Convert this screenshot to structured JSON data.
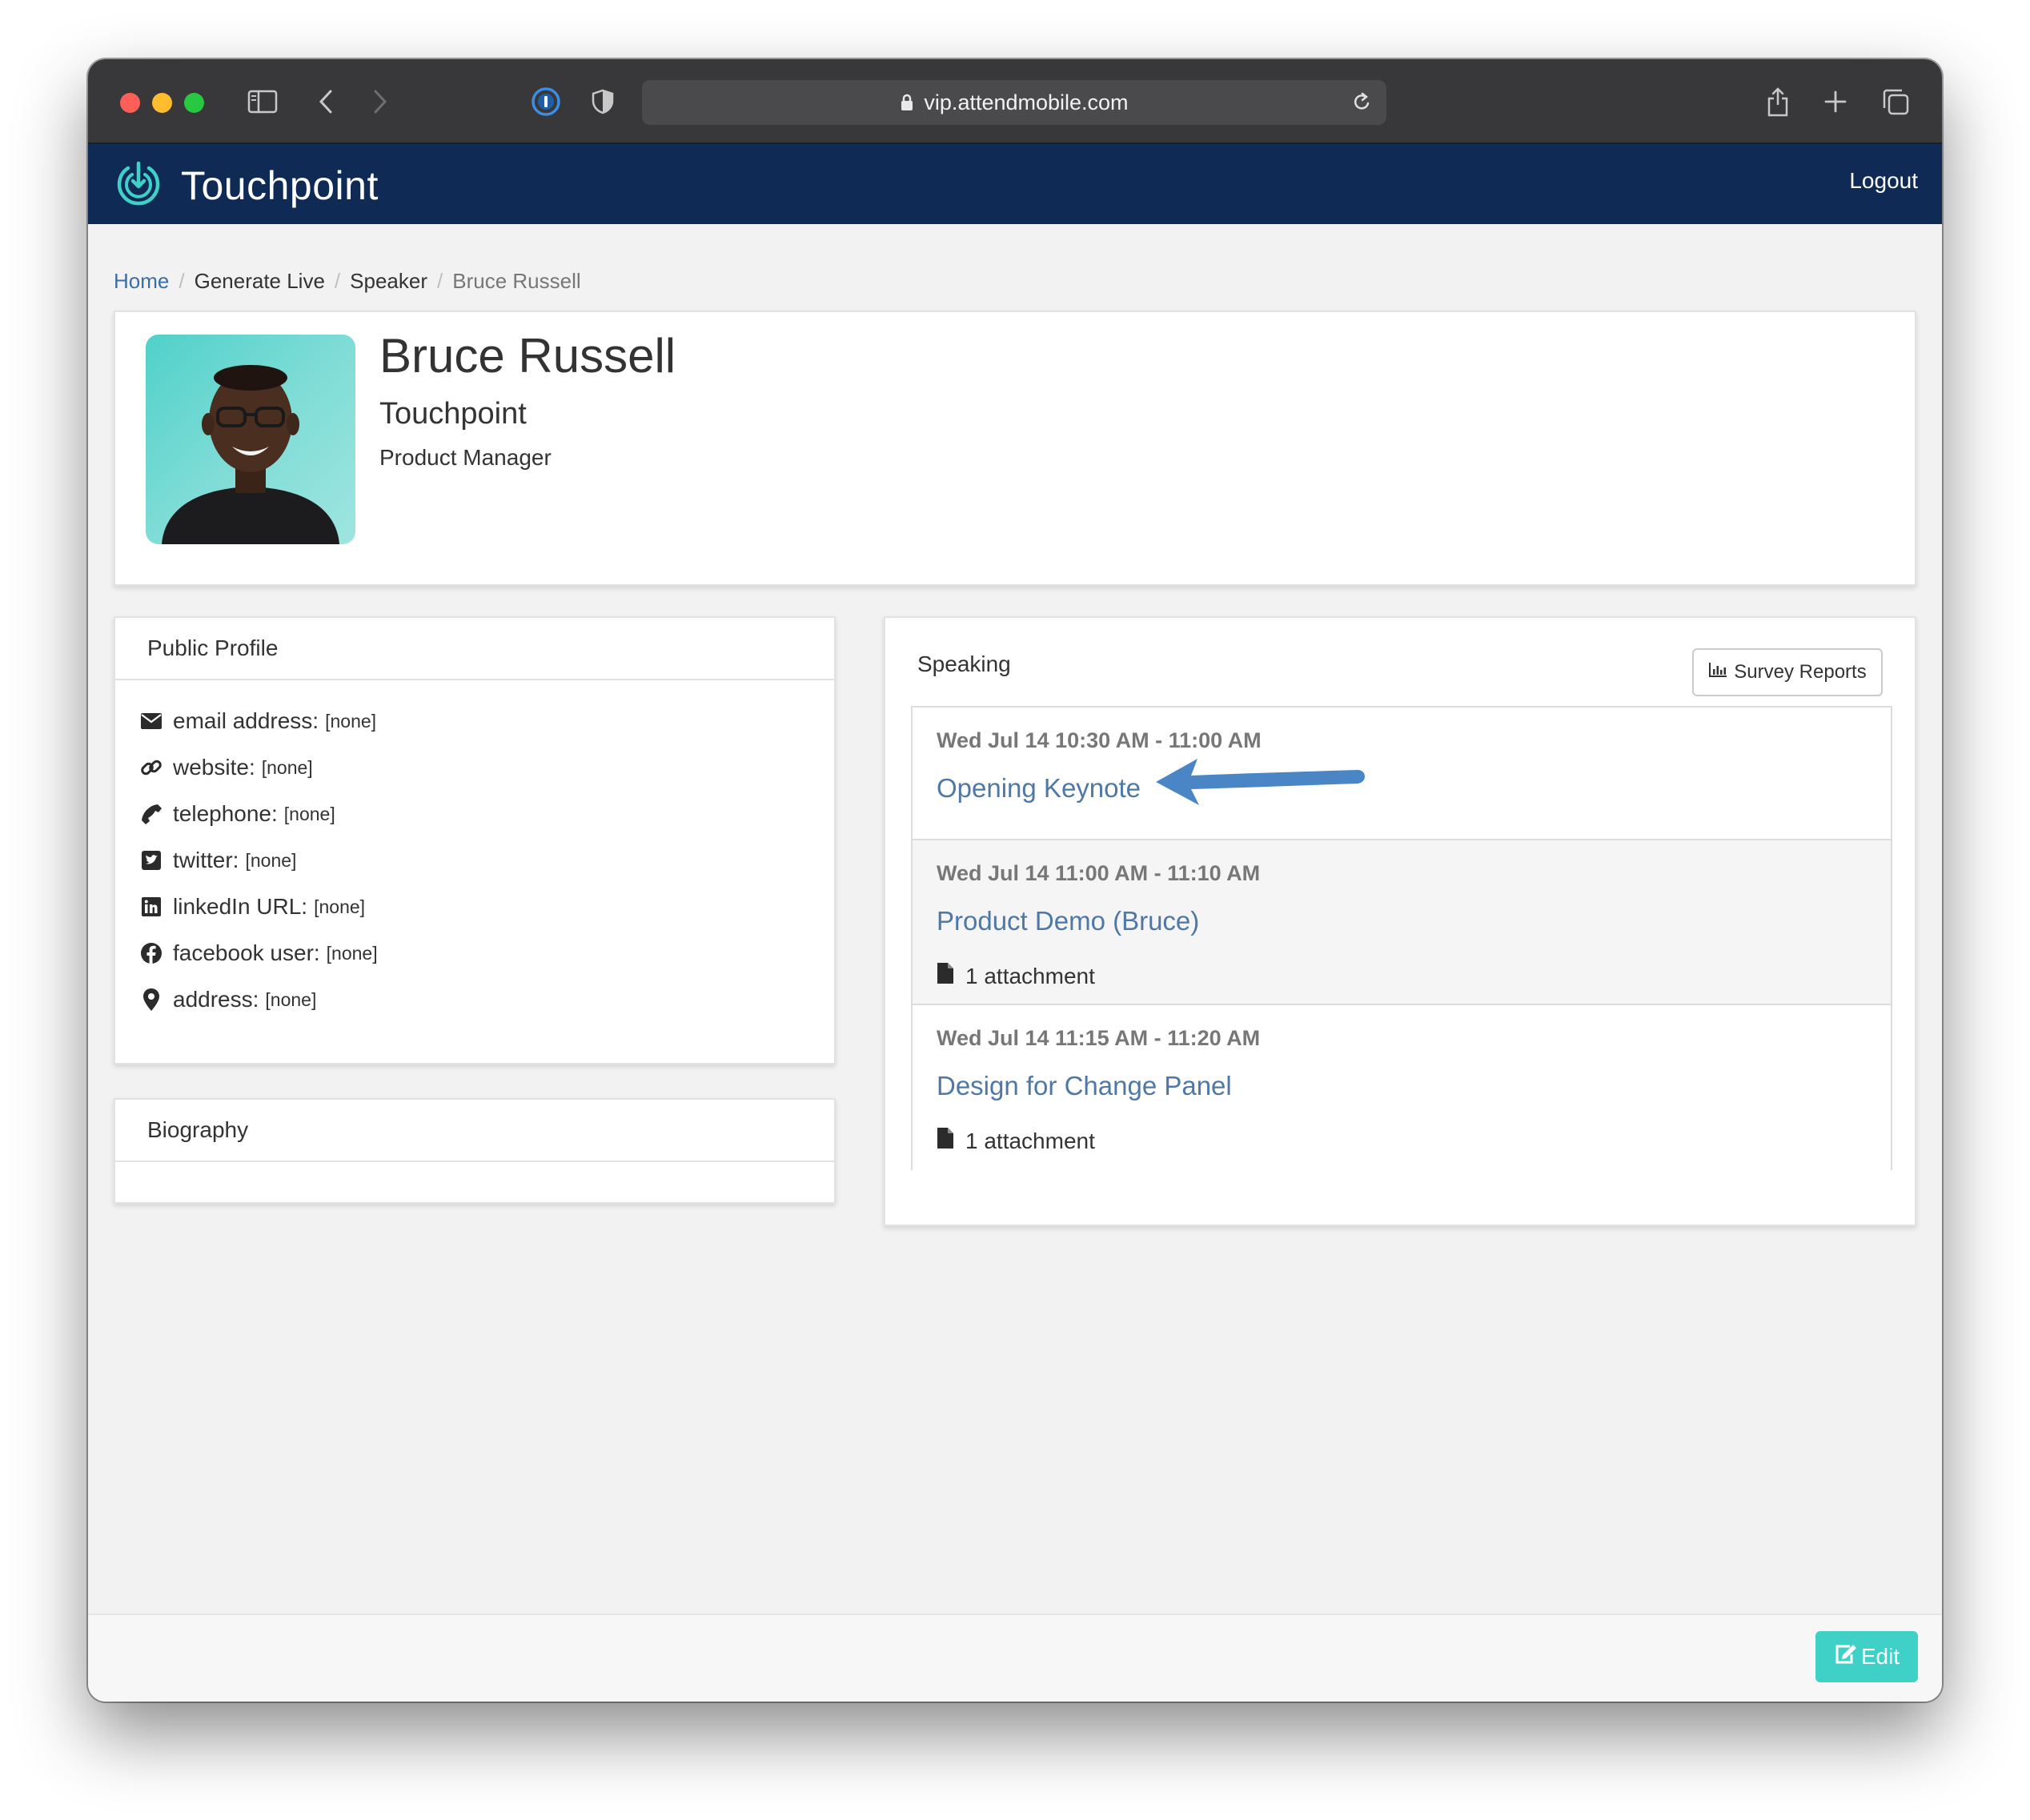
{
  "browser": {
    "url": "vip.attendmobile.com",
    "icons": [
      "sidebar-icon",
      "back-icon",
      "forward-icon",
      "password-manager-icon",
      "privacy-shield-icon",
      "lock-icon",
      "reload-icon",
      "share-icon",
      "new-tab-icon",
      "tab-overview-icon"
    ]
  },
  "header": {
    "brand": "Touchpoint",
    "logout_label": "Logout"
  },
  "breadcrumb": {
    "items": [
      "Home",
      "Generate Live",
      "Speaker",
      "Bruce Russell"
    ],
    "separator": "/"
  },
  "speaker": {
    "name": "Bruce Russell",
    "company": "Touchpoint",
    "title": "Product Manager"
  },
  "public_profile": {
    "heading": "Public Profile",
    "fields": [
      {
        "label": "email address:",
        "value": "[none]",
        "icon": "envelope-icon"
      },
      {
        "label": "website:",
        "value": "[none]",
        "icon": "link-icon"
      },
      {
        "label": "telephone:",
        "value": "[none]",
        "icon": "phone-icon"
      },
      {
        "label": "twitter:",
        "value": "[none]",
        "icon": "twitter-square-icon"
      },
      {
        "label": "linkedIn URL:",
        "value": "[none]",
        "icon": "linkedin-icon"
      },
      {
        "label": "facebook user:",
        "value": "[none]",
        "icon": "facebook-icon"
      },
      {
        "label": "address:",
        "value": "[none]",
        "icon": "map-marker-icon"
      }
    ]
  },
  "biography": {
    "heading": "Biography"
  },
  "speaking": {
    "heading": "Speaking",
    "survey_button": "Survey Reports",
    "sessions": [
      {
        "time": "Wed Jul 14 10:30 AM - 11:00 AM",
        "title": "Opening Keynote"
      },
      {
        "time": "Wed Jul 14 11:00 AM - 11:10 AM",
        "title": "Product Demo (Bruce)",
        "attachment": "1 attachment"
      },
      {
        "time": "Wed Jul 14 11:15 AM - 11:20 AM",
        "title": "Design for Change Panel",
        "attachment": "1 attachment"
      }
    ]
  },
  "footer": {
    "edit_label": "Edit"
  },
  "colors": {
    "appbar": "#0e2a55",
    "link": "#4f78a6",
    "edit_button": "#3fd0c7",
    "annotation_arrow": "#4a86c5"
  }
}
